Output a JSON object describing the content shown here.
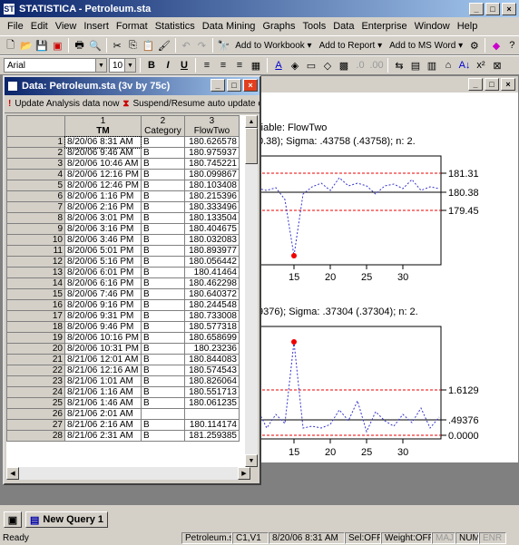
{
  "app": {
    "title": "STATISTICA - Petroleum.sta"
  },
  "menu": [
    "File",
    "Edit",
    "View",
    "Insert",
    "Format",
    "Statistics",
    "Data Mining",
    "Graphs",
    "Tools",
    "Data",
    "Enterprise",
    "Window",
    "Help"
  ],
  "toolbar": {
    "add_workbook": "Add to Workbook",
    "add_report": "Add to Report",
    "add_msword": "Add to MS Word",
    "font_name": "Arial",
    "font_size": "10"
  },
  "graph": {
    "var_label": "riable:  FlowTwo",
    "stats1": "0.38); Sigma: .43758 (.43758); n: 2.",
    "stats2": "9376); Sigma: .37304 (.37304); n: 2.",
    "yticks1": [
      "181.31",
      "180.38",
      "179.45"
    ],
    "yticks2": [
      "1.6129",
      ".49376",
      "0.0000"
    ],
    "xticks": [
      "15",
      "20",
      "25",
      "30"
    ]
  },
  "datawin": {
    "title": "Data: Petroleum.sta (3v by 75c)",
    "update_btn": "Update Analysis data now",
    "suspend_btn": "Suspend/Resume auto update of Analy"
  },
  "columns": [
    {
      "num": "1",
      "name": "TM"
    },
    {
      "num": "2",
      "name": "Category"
    },
    {
      "num": "3",
      "name": "FlowTwo"
    }
  ],
  "rows": [
    [
      "1",
      "8/20/06 8:31 AM",
      "B",
      "180.626578"
    ],
    [
      "2",
      "8/20/06 9:46 AM",
      "B",
      "180.975937"
    ],
    [
      "3",
      "8/20/06 10:46 AM",
      "B",
      "180.745221"
    ],
    [
      "4",
      "8/20/06 12:16 PM",
      "B",
      "180.099867"
    ],
    [
      "5",
      "8/20/06 12:46 PM",
      "B",
      "180.103408"
    ],
    [
      "6",
      "8/20/06 1:16 PM",
      "B",
      "180.215396"
    ],
    [
      "7",
      "8/20/06 2:16 PM",
      "B",
      "180.333496"
    ],
    [
      "8",
      "8/20/06 3:01 PM",
      "B",
      "180.133504"
    ],
    [
      "9",
      "8/20/06 3:16 PM",
      "B",
      "180.404675"
    ],
    [
      "10",
      "8/20/06 3:46 PM",
      "B",
      "180.032083"
    ],
    [
      "11",
      "8/20/06 5:01 PM",
      "B",
      "180.893977"
    ],
    [
      "12",
      "8/20/06 5:16 PM",
      "B",
      "180.056442"
    ],
    [
      "13",
      "8/20/06 6:01 PM",
      "B",
      "180.41464"
    ],
    [
      "14",
      "8/20/06 6:16 PM",
      "B",
      "180.462298"
    ],
    [
      "15",
      "8/20/06 7:46 PM",
      "B",
      "180.640372"
    ],
    [
      "16",
      "8/20/06 9:16 PM",
      "B",
      "180.244548"
    ],
    [
      "17",
      "8/20/06 9:31 PM",
      "B",
      "180.733008"
    ],
    [
      "18",
      "8/20/06 9:46 PM",
      "B",
      "180.577318"
    ],
    [
      "19",
      "8/20/06 10:16 PM",
      "B",
      "180.658699"
    ],
    [
      "20",
      "8/20/06 10:31 PM",
      "B",
      "180.23236"
    ],
    [
      "21",
      "8/21/06 12:01 AM",
      "B",
      "180.844083"
    ],
    [
      "22",
      "8/21/06 12:16 AM",
      "B",
      "180.574543"
    ],
    [
      "23",
      "8/21/06 1:01 AM",
      "B",
      "180.826064"
    ],
    [
      "24",
      "8/21/06 1:16 AM",
      "B",
      "180.551713"
    ],
    [
      "25",
      "8/21/06 1:46 AM",
      "B",
      "180.061235"
    ],
    [
      "26",
      "8/21/06 2:01 AM",
      "",
      ""
    ],
    [
      "27",
      "8/21/06 2:16 AM",
      "B",
      "180.114174"
    ],
    [
      "28",
      "8/21/06 2:31 AM",
      "B",
      "181.259385"
    ]
  ],
  "taskbar": {
    "item": "New Query 1"
  },
  "status": {
    "ready": "Ready",
    "file": "Petroleum.sta",
    "cell": "C1,V1",
    "date": "8/20/06 8:31 AM",
    "sel": "Sel:OFF",
    "weight": "Weight:OFF",
    "maj": "MAJ",
    "num": "NUM",
    "enr": "ENR"
  }
}
